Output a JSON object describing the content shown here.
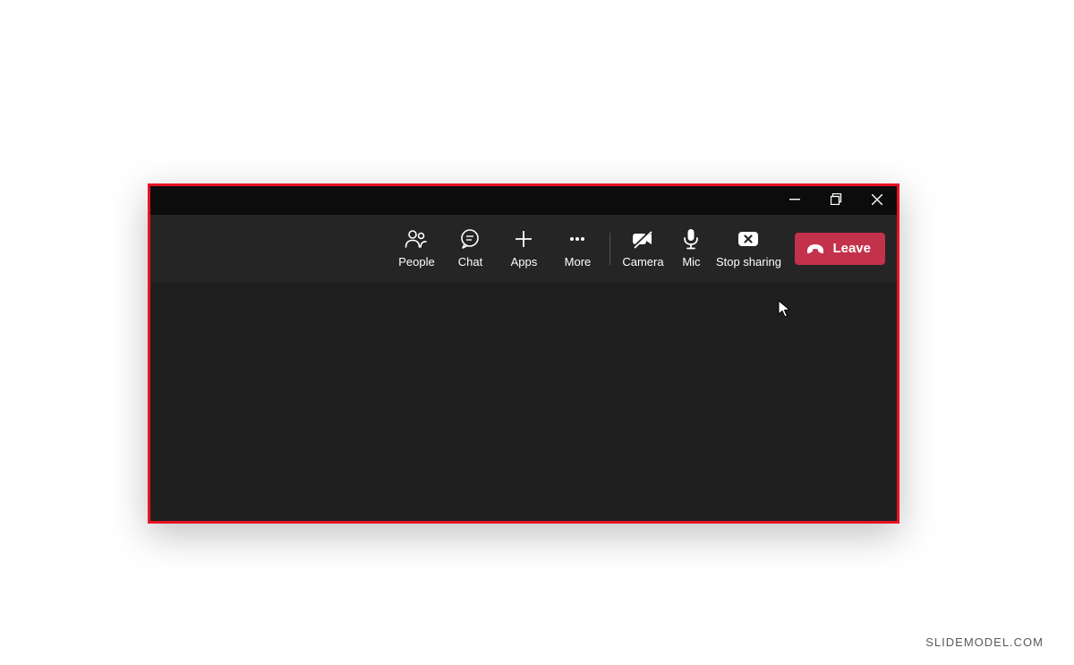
{
  "window": {
    "minimize": "Minimize",
    "restore": "Restore",
    "close": "Close"
  },
  "toolbar": {
    "people": "People",
    "chat": "Chat",
    "apps": "Apps",
    "more": "More",
    "camera": "Camera",
    "mic": "Mic",
    "stop_sharing": "Stop sharing",
    "leave": "Leave"
  },
  "watermark": "SLIDEMODEL.COM",
  "colors": {
    "leave_bg": "#c4314b",
    "sharing_border": "#e81123",
    "toolbar_bg": "#252525",
    "titlebar_bg": "#0c0c0c"
  }
}
